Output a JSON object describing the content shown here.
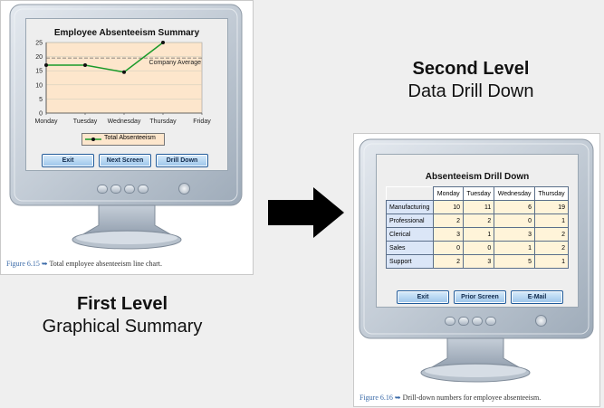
{
  "left_figure": {
    "chart_data": {
      "type": "line",
      "title": "Employee Absenteeism Summary",
      "categories": [
        "Monday",
        "Tuesday",
        "Wednesday",
        "Thursday",
        "Friday"
      ],
      "series": [
        {
          "name": "Total Absenteeism",
          "values": [
            17,
            17,
            14.5,
            25,
            null
          ]
        }
      ],
      "yticks": [
        "0",
        "5",
        "10",
        "15",
        "20",
        "25"
      ],
      "ylim": [
        0,
        25
      ],
      "reference_line": {
        "label": "Company Average",
        "value": 19.5
      },
      "grid": true,
      "legend": "bottom"
    },
    "buttons": [
      "Exit",
      "Next Screen",
      "Drill Down"
    ],
    "caption_fig": "Figure 6.15",
    "caption_text": "Total employee absenteeism line chart."
  },
  "right_figure": {
    "title": "Absenteeism Drill Down",
    "columns": [
      "Monday",
      "Tuesday",
      "Wednesday",
      "Thursday"
    ],
    "rows": [
      {
        "label": "Manufacturing",
        "values": [
          "10",
          "11",
          "6",
          "19"
        ]
      },
      {
        "label": "Professional",
        "values": [
          "2",
          "2",
          "0",
          "1"
        ]
      },
      {
        "label": "Clerical",
        "values": [
          "3",
          "1",
          "3",
          "2"
        ]
      },
      {
        "label": "Sales",
        "values": [
          "0",
          "0",
          "1",
          "2"
        ]
      },
      {
        "label": "Support",
        "values": [
          "2",
          "3",
          "5",
          "1"
        ]
      }
    ],
    "buttons": [
      "Exit",
      "Prior Screen",
      "E-Mail"
    ],
    "caption_fig": "Figure 6.16",
    "caption_text": "Drill-down numbers for employee absenteeism."
  },
  "labels": {
    "first_level_bold": "First Level",
    "first_level_sub": "Graphical Summary",
    "second_level_bold": "Second Level",
    "second_level_sub": "Data Drill Down"
  },
  "colors": {
    "series": "#1a9a2a",
    "chart_bg": "#fde6cc",
    "accent_blue": "#3a6aa8"
  }
}
